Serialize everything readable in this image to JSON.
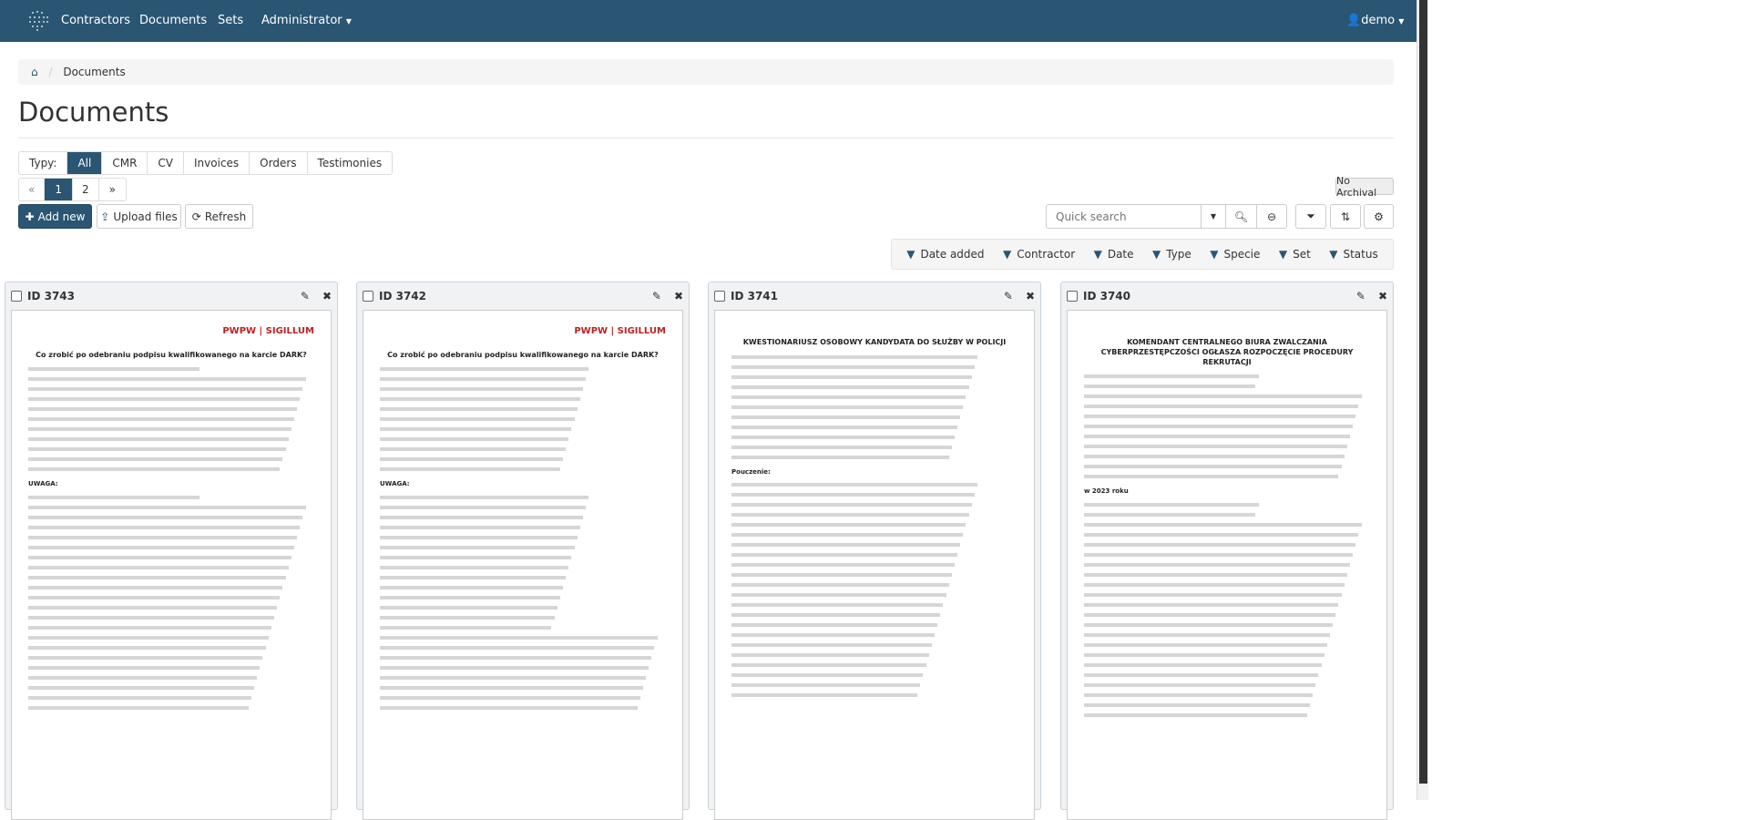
{
  "nav": {
    "items": [
      "Contractors",
      "Documents",
      "Sets",
      "Administrator"
    ],
    "user": "demo"
  },
  "breadcrumb": {
    "current": "Documents"
  },
  "page_title": "Documents",
  "types": {
    "label": "Typy:",
    "items": [
      "All",
      "CMR",
      "CV",
      "Invoices",
      "Orders",
      "Testimonies"
    ],
    "active": "All"
  },
  "pagination": {
    "prev": "«",
    "pages": [
      "1",
      "2"
    ],
    "next": "»",
    "current": "1"
  },
  "archival": "No Archival",
  "actions": {
    "add": "Add new",
    "upload": "Upload files",
    "refresh": "Refresh"
  },
  "search": {
    "placeholder": "Quick search"
  },
  "filters": [
    "Date added",
    "Contractor",
    "Date",
    "Type",
    "Specie",
    "Set",
    "Status"
  ],
  "cards": [
    {
      "id": "ID 3743",
      "brand": "PWPW | SIGILLUM",
      "title": "Co zrobić po odebraniu podpisu kwalifikowanego na karcie DARK?",
      "note": "UWAGA:"
    },
    {
      "id": "ID 3742",
      "brand": "PWPW | SIGILLUM",
      "title": "Co zrobić po odebraniu podpisu kwalifikowanego na karcie DARK?",
      "note": "UWAGA:"
    },
    {
      "id": "ID 3741",
      "brand": "",
      "title": "KWESTIONARIUSZ OSOBOWY KANDYDATA DO SŁUŻBY W POLICJI",
      "note": "Pouczenie:"
    },
    {
      "id": "ID 3740",
      "brand": "",
      "title": "KOMENDANT CENTRALNEGO BIURA ZWALCZANIA CYBERPRZESTĘPCZOŚCI OGŁASZA ROZPOCZĘCIE PROCEDURY REKRUTACJI",
      "note": "w 2023 roku"
    }
  ]
}
